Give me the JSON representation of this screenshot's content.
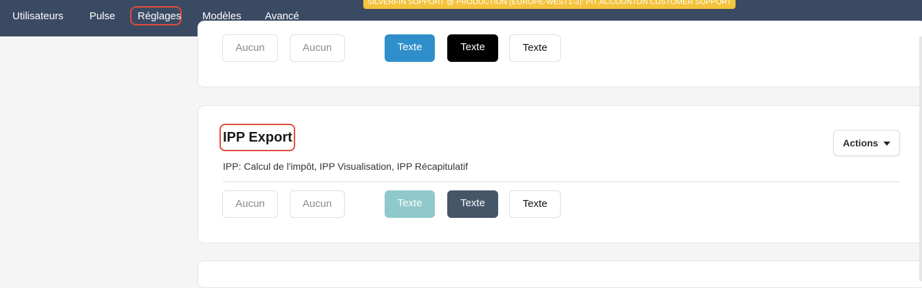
{
  "nav": {
    "items": [
      "Utilisateurs",
      "Pulse",
      "Réglages",
      "Modèles",
      "Avancé"
    ],
    "active_index": 2
  },
  "banner": "SILVERFIN SUPPORT @ PRODUCTION (EUROPE-WEST1-3): PIT ACCOUNTON CUSTOMER SUPPORT",
  "cards": [
    {
      "buttons": [
        "Aucun",
        "Aucun",
        "Texte",
        "Texte",
        "Texte"
      ]
    },
    {
      "title": "IPP Export",
      "description": "IPP: Calcul de l'impôt, IPP Visualisation, IPP Récapitulatif",
      "actions_label": "Actions",
      "buttons": [
        "Aucun",
        "Aucun",
        "Texte",
        "Texte",
        "Texte"
      ]
    }
  ],
  "colors": {
    "nav_bg": "#3b4a63",
    "highlight": "#e14b3b",
    "banner_bg": "#f4c33b",
    "blue": "#2f8fca",
    "teal": "#8fc9cc",
    "slate": "#465669"
  }
}
